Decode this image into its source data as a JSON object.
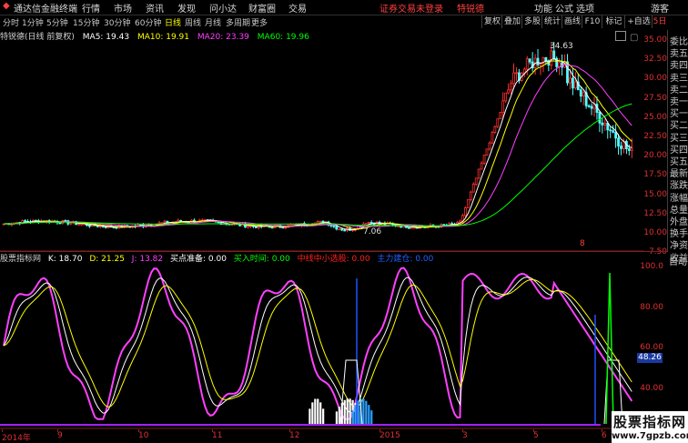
{
  "menubar": {
    "app_title": "通达信金融终端",
    "items": [
      "行情",
      "市场",
      "资讯",
      "发现",
      "问小达",
      "财富圈",
      "交易"
    ],
    "status": "证券交易未登录",
    "stock_name": "特锐德",
    "right_items": [
      "功能",
      "公式",
      "选项",
      "游客"
    ]
  },
  "tabs": [
    "分时",
    "1分钟",
    "5分钟",
    "15分钟",
    "30分钟",
    "60分钟",
    "日线",
    "周线",
    "月线",
    "多周期",
    "更多"
  ],
  "active_tab": "日线",
  "toolbar": [
    "复权",
    "叠加",
    "多股",
    "统计",
    "画线",
    "F10",
    "标记",
    "+自选"
  ],
  "ma_bar": {
    "title": "特锐德(日线 前复权)",
    "ma5": "MA5: 19.43",
    "ma10": "MA10: 19.91",
    "ma20": "MA20: 23.39",
    "ma60": "MA60: 19.96"
  },
  "price_axis": [
    "35.00",
    "32.50",
    "30.00",
    "27.50",
    "25.00",
    "22.50",
    "20.00",
    "17.50",
    "15.00",
    "12.50",
    "10.00",
    "7.50"
  ],
  "price_annotations": {
    "high": "34.63",
    "low": "7.06",
    "marker": "8"
  },
  "indicator_bar": {
    "name": "股票指标网",
    "k": "K: 18.70",
    "d": "D: 21.25",
    "j": "J: 13.82",
    "buy_ready": "买点准备: 0.00",
    "buy_time": "买入时间: 0.00",
    "mid_select": "中线中小选股: 0.00",
    "extra": "主力建仓: 0.00"
  },
  "indicator_axis": [
    "100.0",
    "80.00",
    "60.00",
    "40.00",
    "20.00"
  ],
  "indicator_current": "48.26",
  "right_panel": {
    "corner": "5日",
    "items": [
      "委比",
      "卖五",
      "卖四",
      "卖三",
      "卖二",
      "卖一",
      "买一",
      "买二",
      "买三",
      "买四",
      "买五",
      "最新",
      "涨跌",
      "涨幅",
      "总量",
      "外盘",
      "换手",
      "净资",
      "收益"
    ],
    "auto_label": "自动"
  },
  "x_axis": [
    "2014年",
    "9",
    "10",
    "11",
    "12",
    "2015",
    "3",
    "5",
    "6"
  ],
  "watermark": {
    "line1": "股票指标网",
    "line2": "www.7gpzb.com"
  },
  "colors": {
    "up": "#ff3030",
    "down": "#54ffff",
    "ma5": "#ffffff",
    "ma10": "#ffff00",
    "ma20": "#ff40ff",
    "ma60": "#00ff00",
    "k": "#ffffff",
    "d": "#ffff00",
    "j": "#ff40ff"
  }
}
